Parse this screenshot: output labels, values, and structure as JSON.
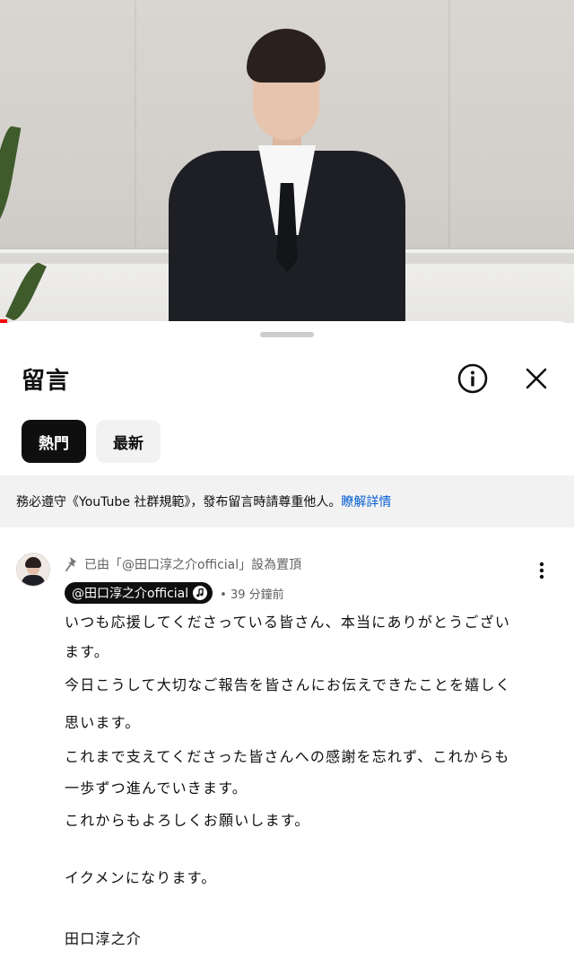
{
  "comments_sheet": {
    "title": "留言",
    "chips": [
      {
        "label": "熱門",
        "selected": true
      },
      {
        "label": "最新",
        "selected": false
      }
    ],
    "notice_text": "務必遵守《YouTube 社群規範》，發布留言時請尊重他人。",
    "notice_link": "瞭解詳情"
  },
  "comment": {
    "pinned_label": "已由「@田口淳之介official」設為置頂",
    "author": "@田口淳之介official",
    "time": "• 39 分鐘前",
    "lines": [
      "いつも応援してくださっている皆さん、本当にありがとうござい",
      "ます。",
      "今日こうして大切なご報告を皆さんにお伝えできたことを嬉しく",
      "思います。",
      "これまで支えてくださった皆さんへの感謝を忘れず、これからも",
      "一歩ずつ進んでいきます。",
      "これからもよろしくお願いします。",
      "イクメンになります。",
      "田口淳之介"
    ]
  },
  "icons": {
    "info": "info-icon",
    "close": "close-icon",
    "pin": "pin-icon",
    "music_note": "music-note-icon",
    "more": "more-vertical-icon"
  },
  "colors": {
    "link": "#065fd4",
    "chip_selected_bg": "#0f0f0f",
    "chip_bg": "#f2f2f2",
    "notice_bg": "#f2f2f2",
    "secondary_text": "#606060",
    "progress": "#ff0000"
  }
}
